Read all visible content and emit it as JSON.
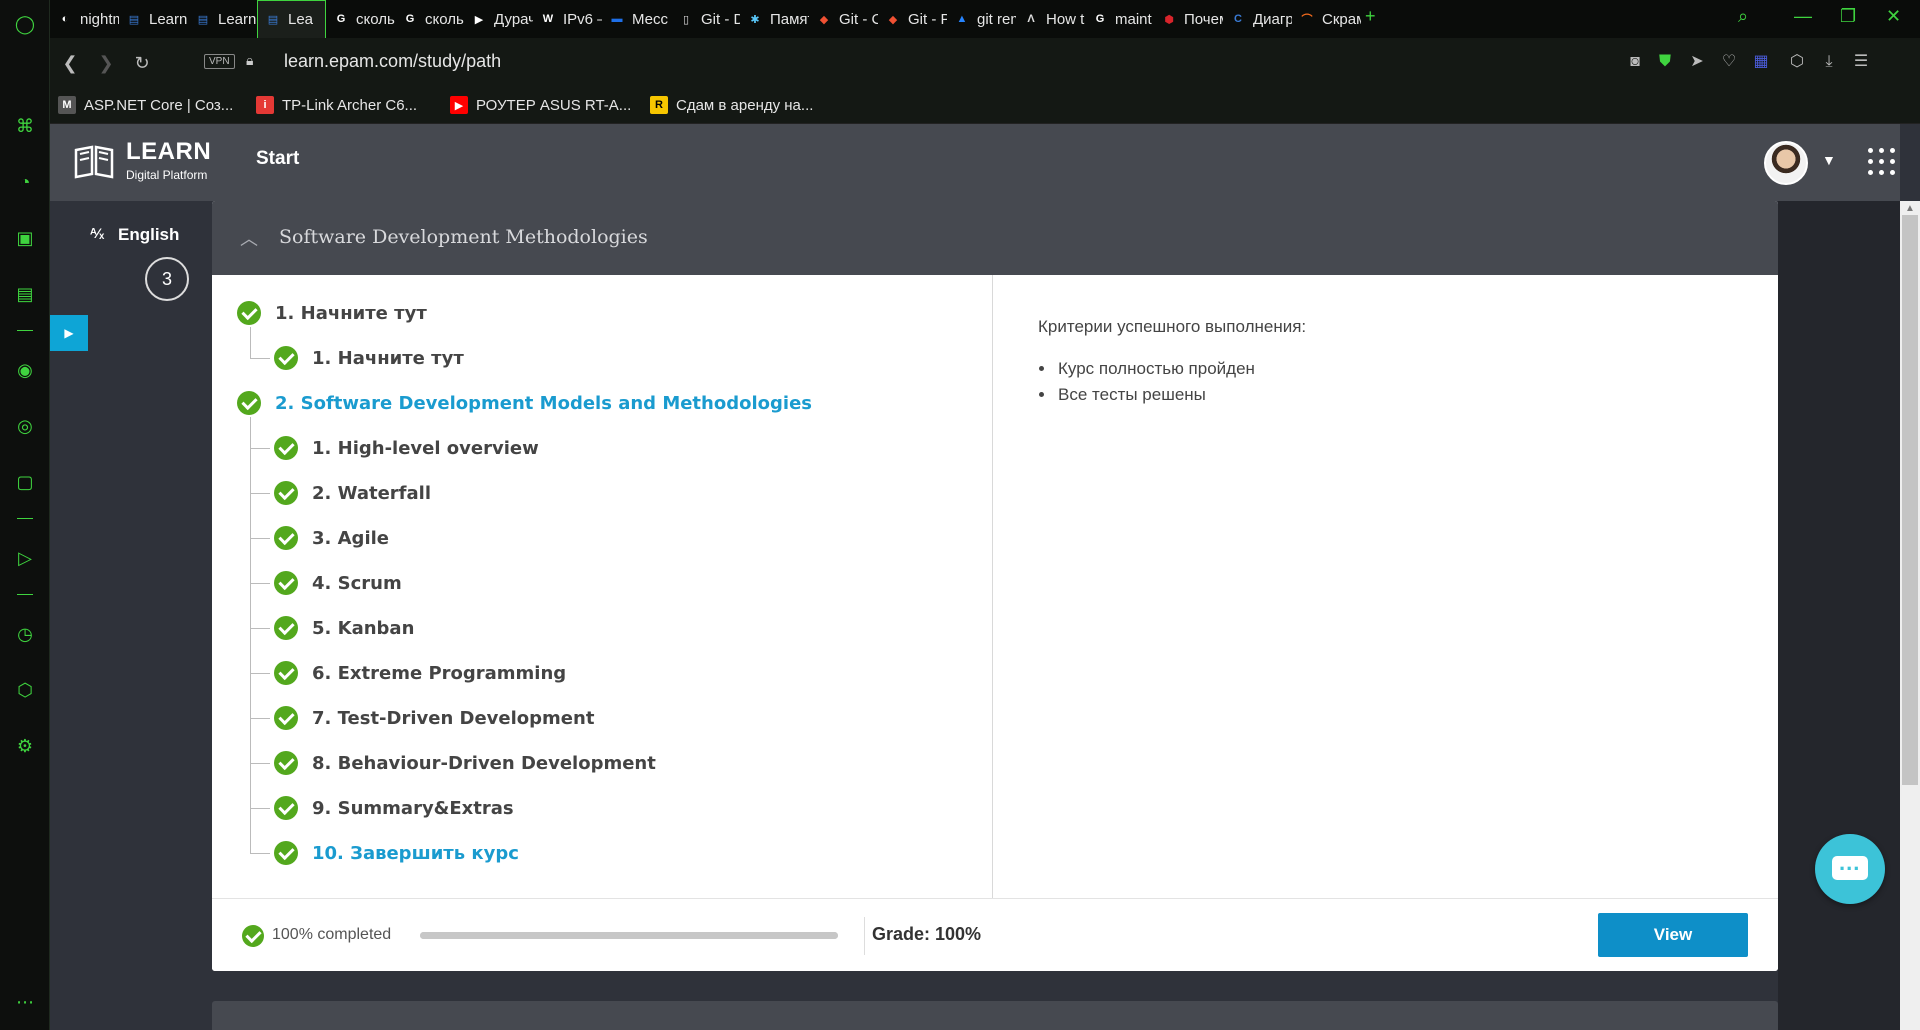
{
  "browser": {
    "tabs": [
      {
        "label": "nightm",
        "fav": "github",
        "color": "#fff"
      },
      {
        "label": "Learn",
        "fav": "book",
        "color": "#3a7bd5"
      },
      {
        "label": "Learn",
        "fav": "book",
        "color": "#3a7bd5"
      },
      {
        "label": "Lea",
        "fav": "book",
        "color": "#3a7bd5",
        "active": true
      },
      {
        "label": "сколь",
        "fav": "google",
        "color": "#fff"
      },
      {
        "label": "сколь",
        "fav": "google",
        "color": "#fff"
      },
      {
        "label": "Дурач",
        "fav": "play",
        "color": "#fff"
      },
      {
        "label": "IPv6 –",
        "fav": "wiki",
        "color": "#fff"
      },
      {
        "label": "Месс",
        "fav": "chat",
        "color": "#1e6fe8"
      },
      {
        "label": "Git - D",
        "fav": "file",
        "color": "#ddd"
      },
      {
        "label": "Памят",
        "fav": "snow",
        "color": "#5ac8fa"
      },
      {
        "label": "Git - C",
        "fav": "git",
        "color": "#f05133"
      },
      {
        "label": "Git - P",
        "fav": "git",
        "color": "#f05133"
      },
      {
        "label": "git rem",
        "fav": "atlassian",
        "color": "#2684ff"
      },
      {
        "label": "How t",
        "fav": "tri",
        "color": "#ddd"
      },
      {
        "label": "maint",
        "fav": "google",
        "color": "#fff"
      },
      {
        "label": "Почем",
        "fav": "hex",
        "color": "#d8242b"
      },
      {
        "label": "Диагр",
        "fav": "c",
        "color": "#3a7bd5"
      },
      {
        "label": "Скрам",
        "fav": "arc",
        "color": "#f26b1d"
      }
    ],
    "address": {
      "vpn": "VPN",
      "url": "learn.epam.com/study/path"
    },
    "bookmarks": [
      {
        "label": "ASP.NET Core | Соз...",
        "fav": "M",
        "color": "#555"
      },
      {
        "label": "TP-Link Archer C6...",
        "fav": "i",
        "color": "#e53935"
      },
      {
        "label": "РОУТЕР ASUS RT-A...",
        "fav": "▶",
        "color": "#ff0000"
      },
      {
        "label": "Сдам в аренду на...",
        "fav": "R",
        "color": "#f7c600"
      }
    ]
  },
  "header": {
    "logo_title": "LEARN",
    "logo_subtitle": "Digital Platform",
    "nav_start": "Start"
  },
  "sidebar": {
    "language": "English",
    "count": "3"
  },
  "course": {
    "title": "Software Development Methodologies",
    "sections": [
      {
        "label": "1. Начните тут",
        "link": false,
        "items": [
          {
            "label": "1. Начните тут",
            "link": false
          }
        ]
      },
      {
        "label": "2. Software Development Models and Methodologies",
        "link": true,
        "items": [
          {
            "label": "1. High-level overview",
            "link": false
          },
          {
            "label": "2. Waterfall",
            "link": false
          },
          {
            "label": "3. Agile",
            "link": false
          },
          {
            "label": "4. Scrum",
            "link": false
          },
          {
            "label": "5. Kanban",
            "link": false
          },
          {
            "label": "6. Extreme Programming",
            "link": false
          },
          {
            "label": "7. Test-Driven Development",
            "link": false
          },
          {
            "label": "8. Behaviour-Driven Development",
            "link": false
          },
          {
            "label": "9. Summary&Extras",
            "link": false
          },
          {
            "label": "10. Завершить курс",
            "link": true
          }
        ]
      }
    ],
    "criteria": {
      "title": "Критерии успешного выполнения:",
      "items": [
        "Курс полностью пройден",
        "Все тесты решены"
      ]
    },
    "footer": {
      "completed": "100% completed",
      "progress": 1.0,
      "grade": "Grade: 100%",
      "view_button": "View"
    }
  },
  "colors": {
    "accent": "#1a9bcf",
    "success": "#53a81d",
    "button": "#0e8fc8",
    "opera_green": "#3fd43f"
  }
}
